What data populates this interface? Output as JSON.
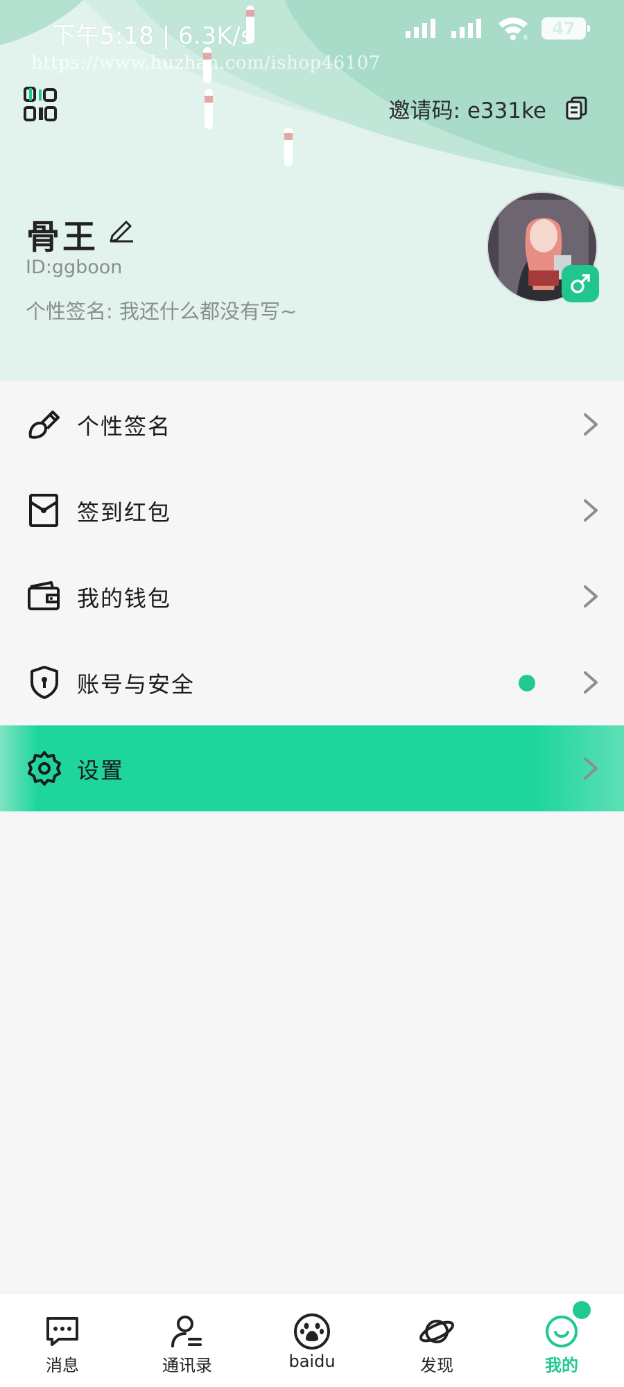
{
  "status_bar": {
    "time_speed": "下午5:18 | 6.3K/s",
    "battery": "47",
    "wifi_badge": "6"
  },
  "watermark": "https://www.huzhan.com/ishop46107",
  "header": {
    "invite_code": "邀请码: e331ke",
    "username": "骨王",
    "user_id": "ID:ggboon",
    "signature": "个性签名: 我还什么都没有写~"
  },
  "menu": {
    "items": [
      {
        "label": "个性签名",
        "icon": "brush-icon"
      },
      {
        "label": "签到红包",
        "icon": "red-envelope-icon"
      },
      {
        "label": "我的钱包",
        "icon": "wallet-icon"
      },
      {
        "label": "账号与安全",
        "icon": "shield-icon"
      },
      {
        "label": "设置",
        "icon": "gear-icon"
      }
    ]
  },
  "bottom_nav": {
    "items": [
      {
        "label": "消息",
        "icon": "chat-icon"
      },
      {
        "label": "通讯录",
        "icon": "contacts-icon"
      },
      {
        "label": "baidu",
        "icon": "baidu-paw-icon"
      },
      {
        "label": "发现",
        "icon": "planet-icon"
      },
      {
        "label": "我的",
        "icon": "smile-icon"
      }
    ],
    "active": "我的"
  },
  "colors": {
    "accent": "#1ed69c",
    "header_bg": "#e2f3ee",
    "page_bg": "#f6f6f6",
    "dot": "#20c990"
  }
}
